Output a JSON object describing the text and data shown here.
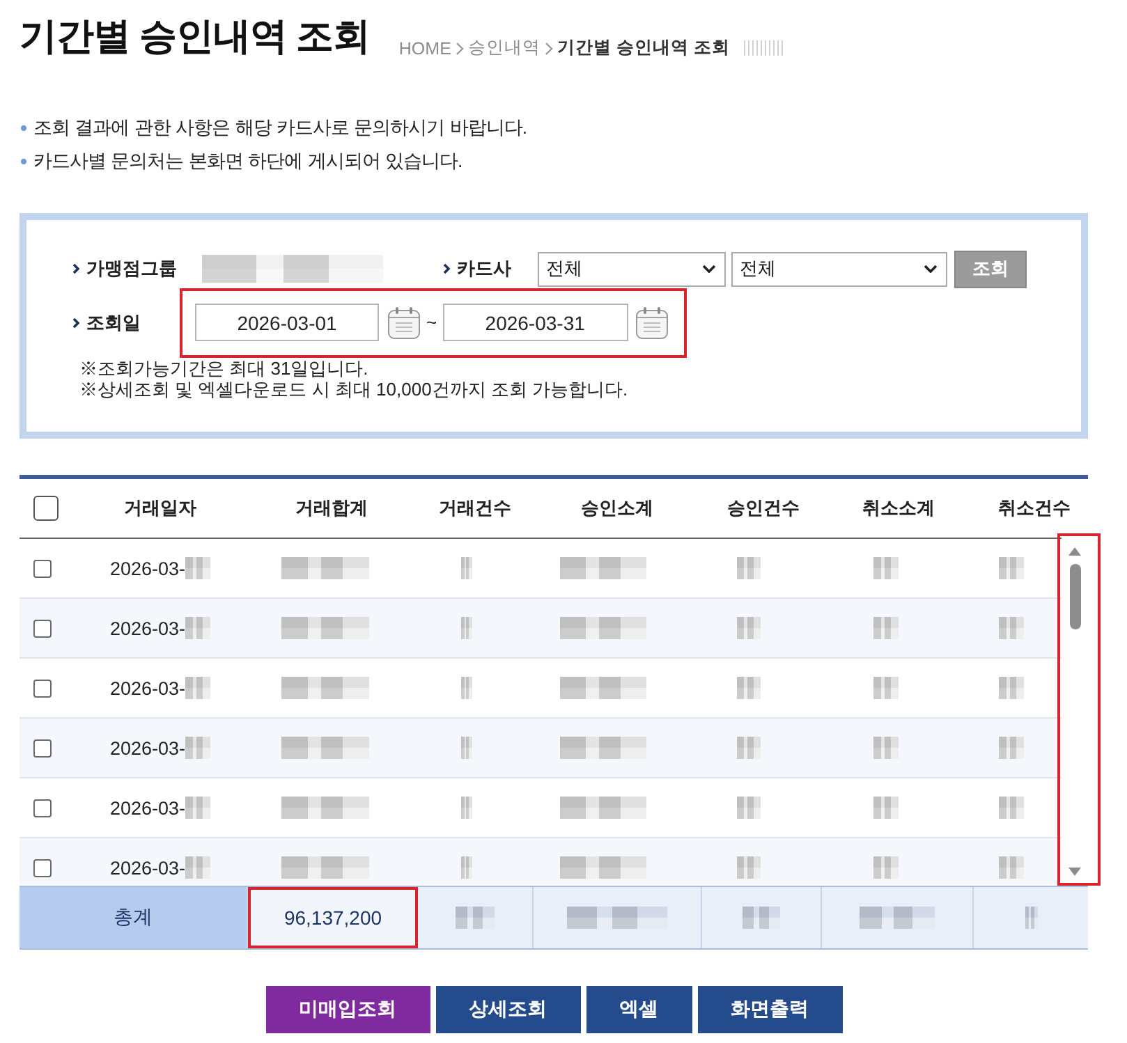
{
  "page": {
    "title": "기간별 승인내역 조회",
    "breadcrumb": [
      {
        "label": "HOME",
        "current": false
      },
      {
        "label": "승인내역",
        "current": false
      },
      {
        "label": "기간별 승인내역 조회",
        "current": true
      }
    ]
  },
  "notices": [
    "조회 결과에 관한 사항은 해당 카드사로 문의하시기 바랍니다.",
    "카드사별 문의처는 본화면 하단에 게시되어 있습니다."
  ],
  "search": {
    "merchant_group": {
      "label": "가맹점그룹"
    },
    "card_company": {
      "label": "카드사",
      "selects": [
        {
          "value": "전체"
        },
        {
          "value": "전체"
        }
      ],
      "button": "조회"
    },
    "date_range": {
      "label": "조회일",
      "from": "2026-03-01",
      "separator": "~",
      "to": "2026-03-31",
      "highlighted": true
    },
    "notes": [
      "※조회가능기간은 최대 31일입니다.",
      "※상세조회 및 엑셀다운로드 시 최대 10,000건까지 조회 가능합니다."
    ]
  },
  "table": {
    "select_all": {
      "checked": false
    },
    "columns": [
      "거래일자",
      "거래합계",
      "거래건수",
      "승인소계",
      "승인건수",
      "취소소계",
      "취소건수"
    ],
    "rows": [
      {
        "date": "2026-03-",
        "checked": false
      },
      {
        "date": "2026-03-",
        "checked": false
      },
      {
        "date": "2026-03-",
        "checked": false
      },
      {
        "date": "2026-03-",
        "checked": false
      },
      {
        "date": "2026-03-",
        "checked": false
      },
      {
        "date": "2026-03-",
        "checked": false
      }
    ],
    "scrollbar": {
      "highlighted": true
    },
    "total": {
      "label": "총계",
      "value": "96,137,200",
      "highlighted": true
    }
  },
  "buttons": [
    {
      "label": "미매입조회",
      "kind": "accent"
    },
    {
      "label": "상세조회",
      "kind": "primary"
    },
    {
      "label": "엑셀",
      "kind": "primary"
    },
    {
      "label": "화면출력",
      "kind": "primary"
    }
  ]
}
